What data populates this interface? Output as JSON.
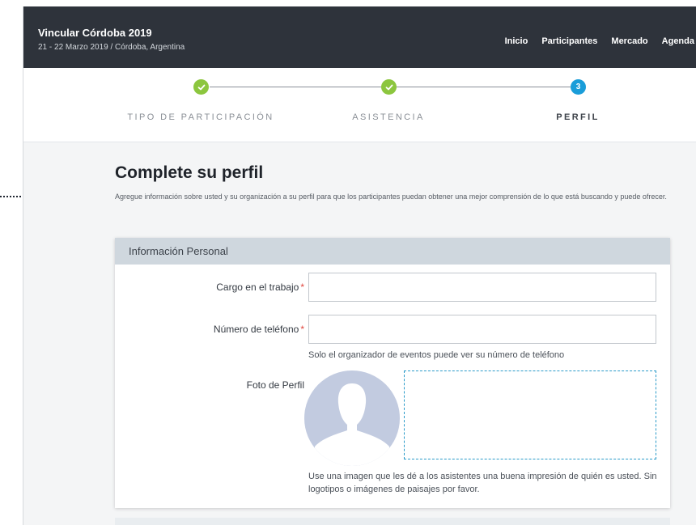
{
  "header": {
    "event_title": "Vincular Córdoba 2019",
    "event_subtitle": "21 - 22 Marzo 2019 / Córdoba, Argentina",
    "nav": [
      "Inicio",
      "Participantes",
      "Mercado",
      "Agenda"
    ],
    "background_color": "#2e333b"
  },
  "stepper": {
    "steps": [
      {
        "label": "TIPO DE PARTICIPACIÓN",
        "status": "done",
        "marker": "check-icon"
      },
      {
        "label": "ASISTENCIA",
        "status": "done",
        "marker": "check-icon"
      },
      {
        "label": "PERFIL",
        "status": "active",
        "number": "3"
      }
    ],
    "done_color": "#8cc63e",
    "active_color": "#1a9dd9"
  },
  "page": {
    "title": "Complete su perfil",
    "description": "Agregue información sobre usted y su organización a su perfil para que los participantes puedan obtener una mejor comprensión de lo que está buscando y puede ofrecer."
  },
  "form": {
    "section_title": "Información Personal",
    "fields": {
      "job_title": {
        "label": "Cargo en el trabajo",
        "required_mark": "*",
        "value": ""
      },
      "phone": {
        "label": "Número de teléfono",
        "required_mark": "*",
        "value": "",
        "hint": "Solo el organizador de eventos puede ver su número de teléfono"
      },
      "photo": {
        "label": "Foto de Perfil",
        "hint": "Use una imagen que les dé a los asistentes una buena impresión de quién es usted. Sin logotipos o imágenes de paisajes por favor."
      }
    },
    "required_color": "#e0463e",
    "dropzone_color": "#2a9bc9"
  }
}
